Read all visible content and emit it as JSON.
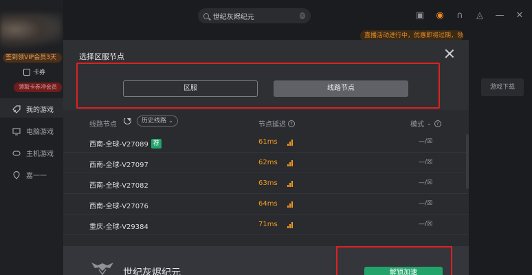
{
  "sidebar": {
    "promo": "签到领VIP会员3天",
    "card_label": "卡券",
    "red_badge": "领取卡券冲会员",
    "items": [
      {
        "label": "我的游戏",
        "icon": "rocket-icon"
      },
      {
        "label": "电脑游戏",
        "icon": "monitor-icon"
      },
      {
        "label": "主机游戏",
        "icon": "gamepad-icon"
      },
      {
        "label": "嘉一一",
        "icon": "location-icon"
      }
    ]
  },
  "topbar": {
    "search_value": "世纪灰烬纪元",
    "search_clear": "×",
    "notice": "直播活动进行中，优惠即将过期，领取不停 ×",
    "right_download": "游戏下载"
  },
  "modal": {
    "title": "选择区服节点",
    "tabs": [
      "区服",
      "线路节点"
    ],
    "list_head": {
      "node": "线路节点",
      "history": "历史线路",
      "delay": "节点延迟",
      "mode": "模式"
    },
    "rows": [
      {
        "name": "西南-全球-V27089",
        "badge": "荐",
        "ms": "61ms",
        "mode": "—/☒"
      },
      {
        "name": "西南-全球-V27097",
        "badge": "",
        "ms": "62ms",
        "mode": "—/☒"
      },
      {
        "name": "西南-全球-V27082",
        "badge": "",
        "ms": "63ms",
        "mode": "—/☒"
      },
      {
        "name": "西南-全球-V27076",
        "badge": "",
        "ms": "64ms",
        "mode": "—/☒"
      },
      {
        "name": "重庆-全球-V29384",
        "badge": "",
        "ms": "71ms",
        "mode": "—/☒"
      }
    ],
    "game_title": "世纪灰烬纪元",
    "start_button": "解锁加速"
  },
  "colors": {
    "accent_green": "#22a36a",
    "latency_orange": "#f29a1f",
    "highlight_red": "#e02020"
  }
}
